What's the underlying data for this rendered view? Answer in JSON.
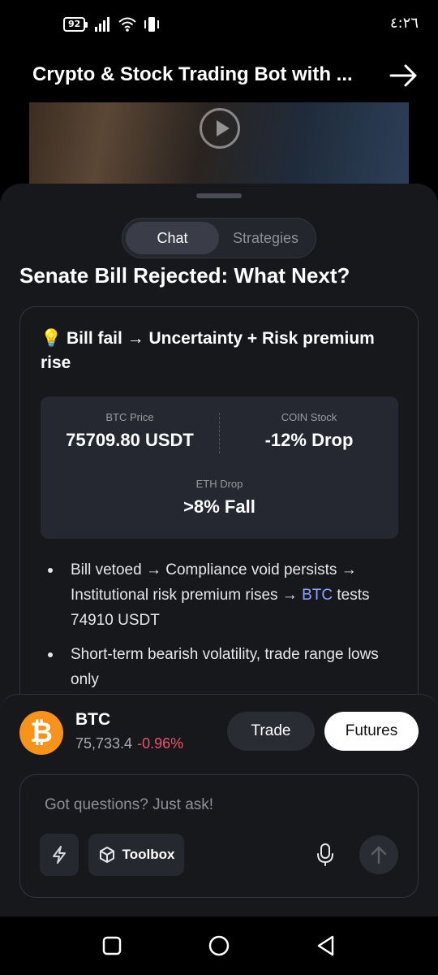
{
  "status_bar": {
    "battery": "92",
    "time": "٤:٢٦"
  },
  "video": {
    "title": "Crypto & Stock Trading Bot with ..."
  },
  "tabs": [
    {
      "label": "Chat"
    },
    {
      "label": "Strategies"
    }
  ],
  "article": {
    "title": "Senate Bill Rejected: What Next?",
    "headline_emoji": "💡",
    "headline": "Bill fail → Uncertainty + Risk premium rise",
    "stats": [
      {
        "label": "BTC Price",
        "value": "75709.80 USDT"
      },
      {
        "label": "COIN Stock",
        "value": "-12% Drop"
      },
      {
        "label": "ETH Drop",
        "value": ">8% Fall"
      }
    ],
    "bullets": [
      {
        "pre": "Bill vetoed → Compliance void persists → Institutional risk premium rises → ",
        "link": "BTC",
        "post": " tests 74910 USDT"
      },
      {
        "text": "Short-term bearish volatility, trade range lows only"
      }
    ]
  },
  "asset": {
    "logo_glyph": "₿",
    "symbol": "BTC",
    "price": "75,733.4",
    "change": "-0.96%",
    "trade_label": "Trade",
    "futures_label": "Futures"
  },
  "composer": {
    "placeholder": "Got questions? Just ask!",
    "toolbox_label": "Toolbox"
  },
  "colors": {
    "accent_link": "#8aa6ff",
    "negative": "#f0506e",
    "btc_orange": "#f7931a"
  }
}
